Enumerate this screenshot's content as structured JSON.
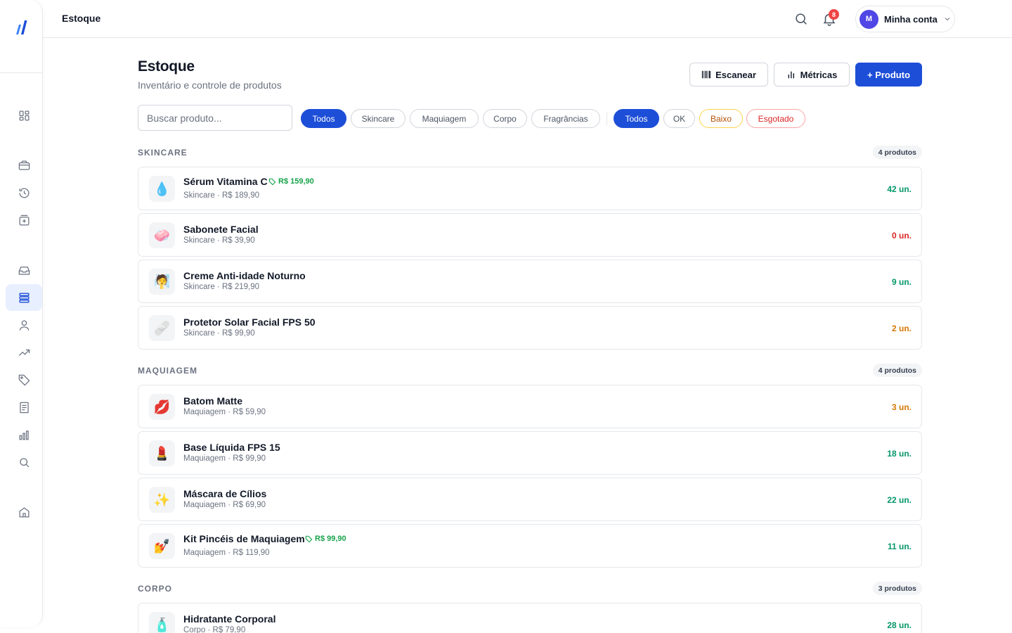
{
  "header": {
    "title": "Estoque",
    "notifications": "8",
    "account": {
      "initial": "M",
      "label": "Minha conta"
    }
  },
  "sidebar": {
    "icons": [
      "logo-icon",
      "dashboard-icon",
      "wallet-icon",
      "history-icon",
      "add-box-icon",
      "inbox-icon",
      "stock-list-icon",
      "user-icon",
      "trending-icon",
      "tag-icon",
      "document-icon",
      "bar-chart-icon",
      "search-icon",
      "store-icon"
    ],
    "active": "stock-list-icon"
  },
  "page": {
    "title": "Estoque",
    "subtitle": "Inventário e controle de produtos"
  },
  "actions": {
    "scan": "Escanear",
    "metrics": "Métricas",
    "add": "+ Produto"
  },
  "search": {
    "placeholder": "Buscar produto..."
  },
  "category_filters": [
    {
      "label": "Todos",
      "active": true
    },
    {
      "label": "Skincare",
      "active": false
    },
    {
      "label": "Maquiagem",
      "active": false
    },
    {
      "label": "Corpo",
      "active": false
    },
    {
      "label": "Fragrâncias",
      "active": false
    }
  ],
  "status_filters": [
    {
      "label": "Todos",
      "active": true
    },
    {
      "label": "OK",
      "active": false
    },
    {
      "label": "Baixo",
      "active": false
    },
    {
      "label": "Esgotado",
      "active": false
    }
  ],
  "sections": [
    {
      "label": "SKINCARE",
      "count": "4 produtos",
      "products": [
        {
          "icon": "💧",
          "name": "Sérum Vitamina C",
          "promo": "R$ 159,90",
          "meta": "Skincare · R$ 189,90",
          "qty": "42 un.",
          "status": "ok"
        },
        {
          "icon": "🧼",
          "name": "Sabonete Facial",
          "promo": "",
          "meta": "Skincare · R$ 39,90",
          "qty": "0 un.",
          "status": "out"
        },
        {
          "icon": "🧖",
          "name": "Creme Anti-idade Noturno",
          "promo": "",
          "meta": "Skincare · R$ 219,90",
          "qty": "9 un.",
          "status": "ok"
        },
        {
          "icon": "🩹",
          "name": "Protetor Solar Facial FPS 50",
          "promo": "",
          "meta": "Skincare · R$ 99,90",
          "qty": "2 un.",
          "status": "low"
        }
      ]
    },
    {
      "label": "MAQUIAGEM",
      "count": "4 produtos",
      "products": [
        {
          "icon": "💋",
          "name": "Batom Matte",
          "promo": "",
          "meta": "Maquiagem · R$ 59,90",
          "qty": "3 un.",
          "status": "low"
        },
        {
          "icon": "💄",
          "name": "Base Líquida FPS 15",
          "promo": "",
          "meta": "Maquiagem · R$ 99,90",
          "qty": "18 un.",
          "status": "ok"
        },
        {
          "icon": "✨",
          "name": "Máscara de Cílios",
          "promo": "",
          "meta": "Maquiagem · R$ 69,90",
          "qty": "22 un.",
          "status": "ok"
        },
        {
          "icon": "💅",
          "name": "Kit Pincéis de Maquiagem",
          "promo": "R$ 99,90",
          "meta": "Maquiagem · R$ 119,90",
          "qty": "11 un.",
          "status": "ok"
        }
      ]
    },
    {
      "label": "CORPO",
      "count": "3 produtos",
      "products": [
        {
          "icon": "🧴",
          "name": "Hidratante Corporal",
          "promo": "",
          "meta": "Corpo · R$ 79,90",
          "qty": "28 un.",
          "status": "ok"
        }
      ]
    }
  ],
  "colors": {
    "primary": "#1d4ed8",
    "ok": "#059669",
    "low": "#d97706",
    "out": "#dc2626",
    "promo": "#16a34a"
  }
}
